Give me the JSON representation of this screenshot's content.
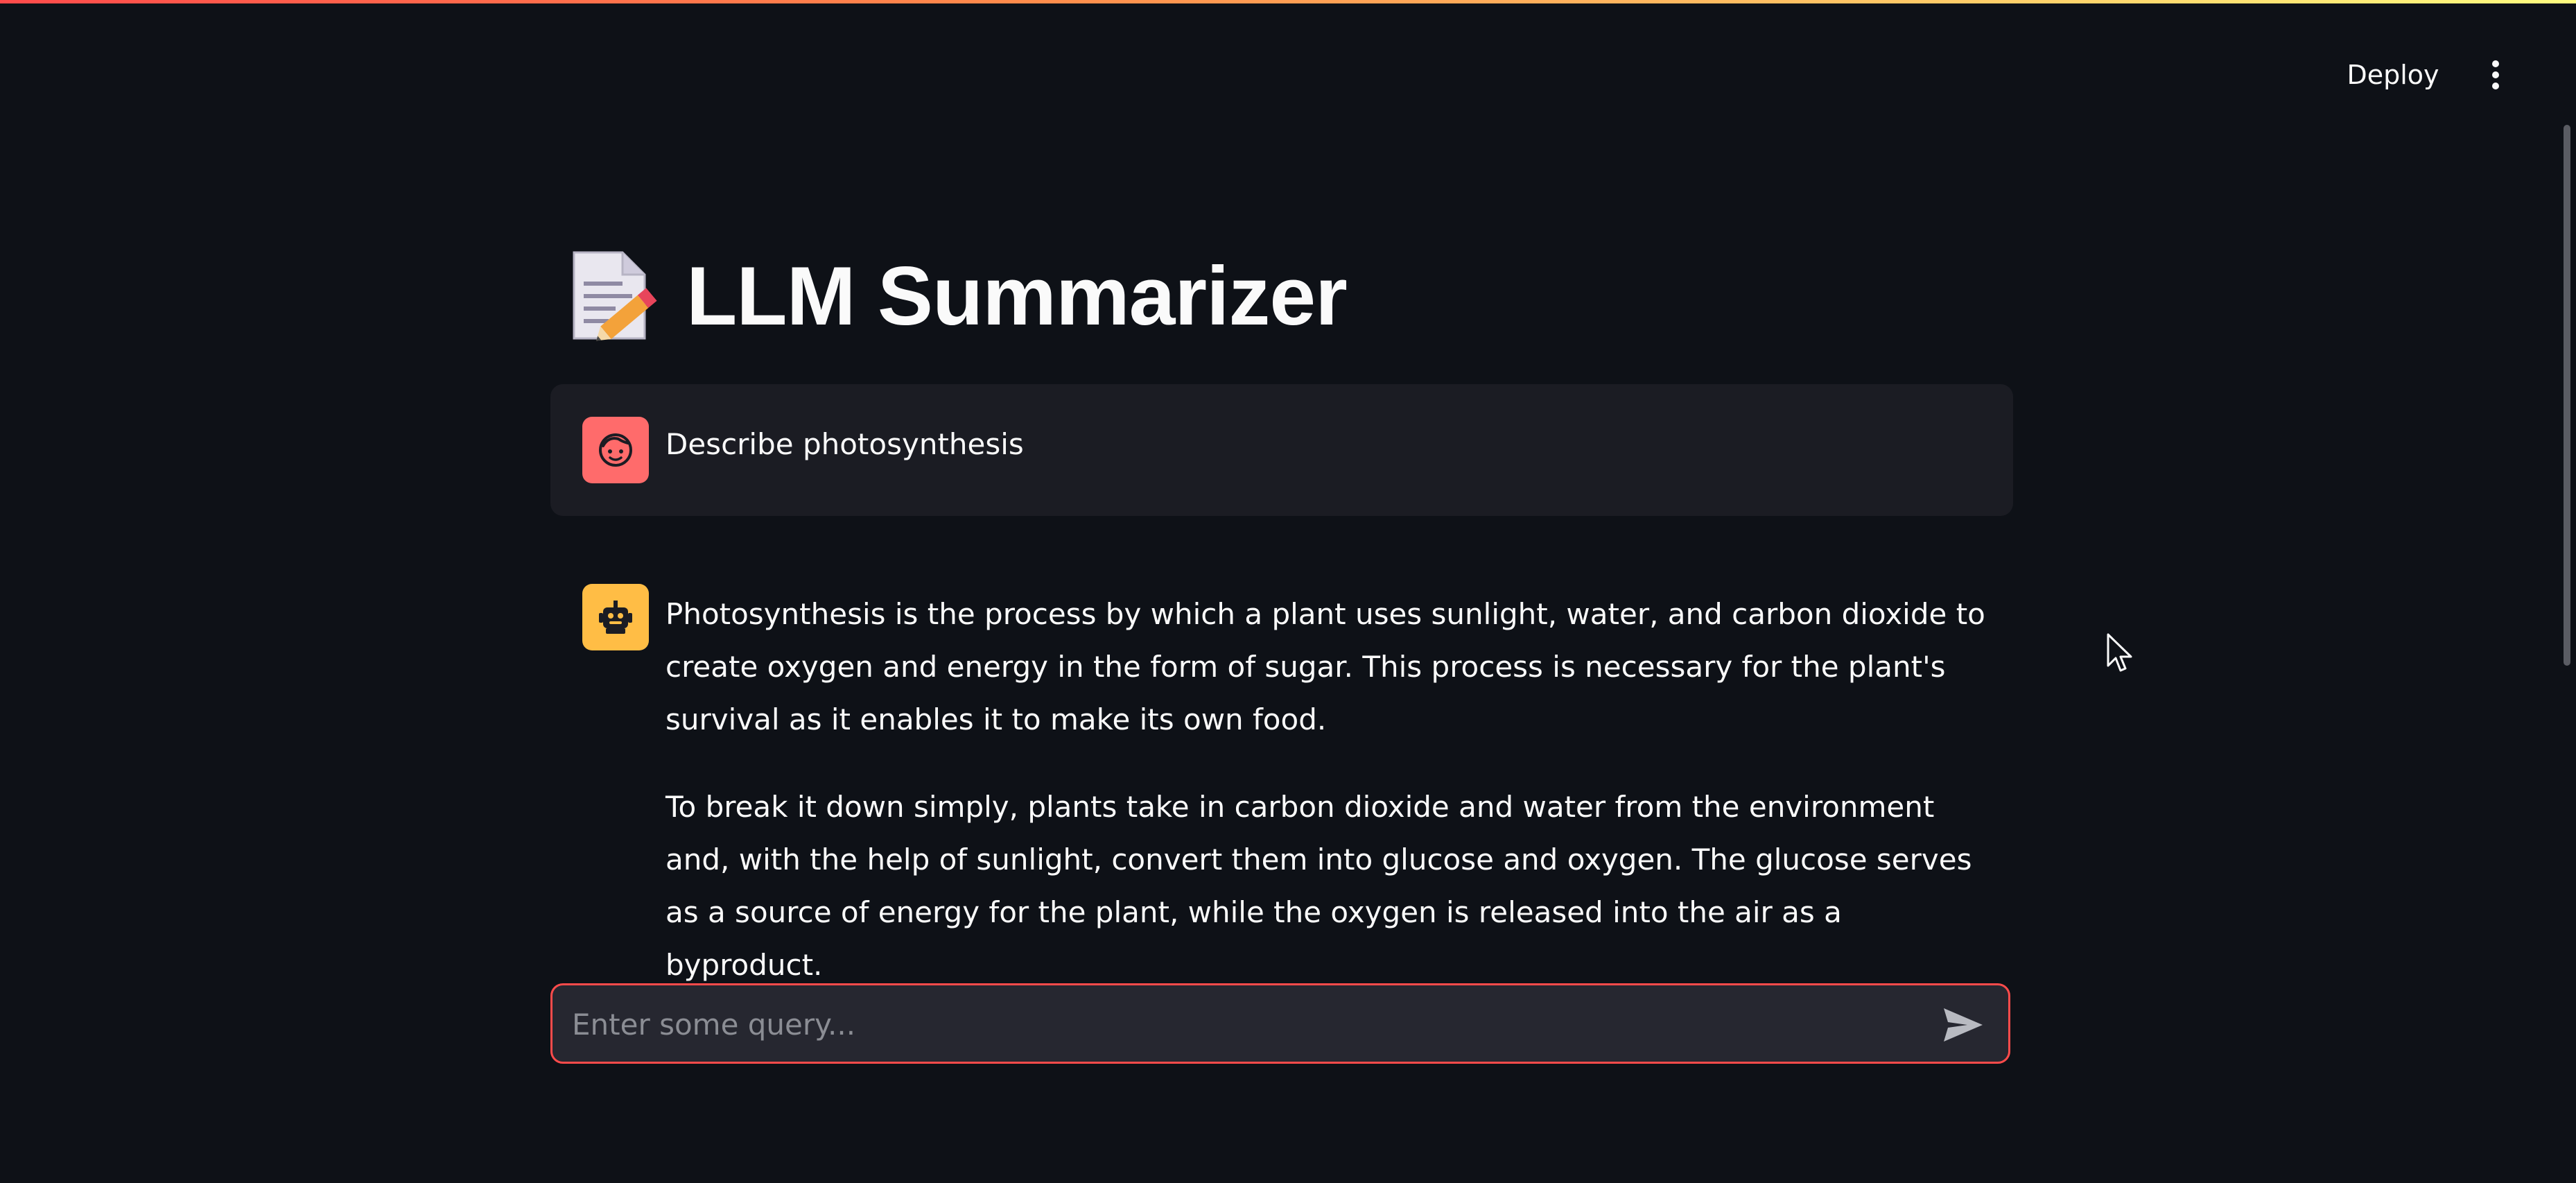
{
  "header": {
    "deploy_label": "Deploy",
    "menu_icon": "vertical-ellipsis-icon",
    "accent_gradient": [
      "#ff4b4b",
      "#ffd36b",
      "#fffd80"
    ]
  },
  "main": {
    "title_icon": "memo-icon",
    "title": "LLM Summarizer"
  },
  "chat": {
    "messages": [
      {
        "role": "user",
        "avatar_icon": "user-face-icon",
        "avatar_color": "#ff6b6b",
        "text": "Describe photosynthesis"
      },
      {
        "role": "assistant",
        "avatar_icon": "robot-icon",
        "avatar_color": "#ffbd45",
        "paragraphs": [
          "Photosynthesis is the process by which a plant uses sunlight, water, and carbon dioxide to create oxygen and energy in the form of sugar. This process is necessary for the plant's survival as it enables it to make its own food.",
          "To break it down simply, plants take in carbon dioxide and water from the environment and, with the help of sunlight, convert them into glucose and oxygen. The glucose serves as a source of energy for the plant, while the oxygen is released into the air as a byproduct."
        ]
      }
    ],
    "input": {
      "placeholder": "Enter some query...",
      "value": "",
      "send_icon": "send-icon",
      "border_color": "#ff4b4b"
    }
  },
  "colors": {
    "background": "#0e1117",
    "user_bubble": "#1b1c23",
    "input_bg": "#262730",
    "text": "#fafafa"
  }
}
